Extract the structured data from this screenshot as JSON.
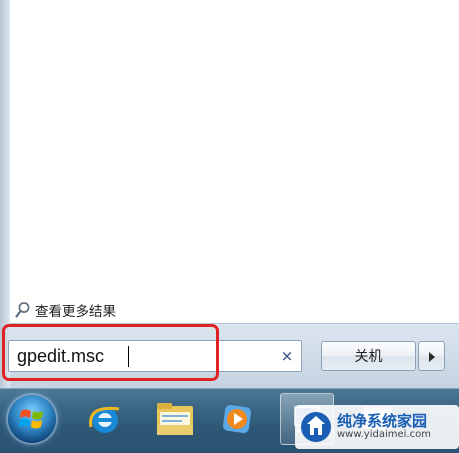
{
  "start_menu": {
    "see_more_results": "查看更多结果",
    "search": {
      "value": "gpedit.msc",
      "clear_glyph": "×"
    },
    "shutdown_label": "关机",
    "arrow_glyph": "▶"
  },
  "taskbar": {
    "items": [
      {
        "name": "windows-start-orb"
      },
      {
        "name": "internet-explorer-icon"
      },
      {
        "name": "windows-explorer-icon"
      },
      {
        "name": "media-player-icon"
      },
      {
        "name": "control-panel-icon"
      },
      {
        "name": "window-app-icon"
      }
    ]
  },
  "watermark": {
    "title": "纯净系统家园",
    "url": "www.yidaimei.com"
  },
  "colors": {
    "highlight": "#e02424",
    "taskbar": "#2e5876",
    "brand": "#1a5fb4"
  }
}
